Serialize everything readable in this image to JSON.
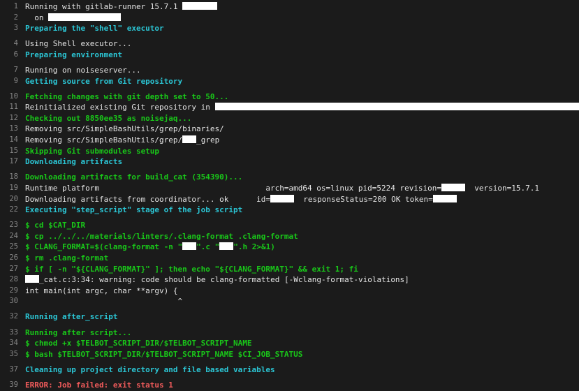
{
  "terminal": {
    "title": "GitLab CI job log",
    "background_color": "#1b1b1b",
    "colors": {
      "plain": "#e4e4e4",
      "section_header": "#2bc5d4",
      "status_green": "#19c719",
      "command_green": "#19c719",
      "error_red": "#f15b5b",
      "line_number": "#868686",
      "redaction": "#ffffff"
    },
    "lines": [
      {
        "number": "1",
        "style": "plain",
        "gap": false,
        "pre": "Running with gitlab-runner 15.7.1 ",
        "redact": "md",
        "post": ""
      },
      {
        "number": "2",
        "style": "plain",
        "gap": false,
        "pre": "  on ",
        "redact": "xl",
        "post": ""
      },
      {
        "number": "3",
        "style": "section",
        "gap": false,
        "text": "Preparing the \"shell\" executor"
      },
      {
        "number": "4",
        "style": "plain",
        "gap": true,
        "text": "Using Shell executor..."
      },
      {
        "number": "6",
        "style": "section",
        "gap": false,
        "text": "Preparing environment"
      },
      {
        "number": "7",
        "style": "plain",
        "gap": true,
        "text": "Running on noiseserver..."
      },
      {
        "number": "9",
        "style": "section",
        "gap": false,
        "text": "Getting source from Git repository"
      },
      {
        "number": "10",
        "style": "green",
        "gap": true,
        "text": "Fetching changes with git depth set to 50..."
      },
      {
        "number": "11",
        "style": "plain",
        "gap": false,
        "pre": "Reinitialized existing Git repository in ",
        "redact": "fill",
        "post": ""
      },
      {
        "number": "12",
        "style": "green",
        "gap": false,
        "text": "Checking out 8850ee35 as noisejaq..."
      },
      {
        "number": "13",
        "style": "plain",
        "gap": false,
        "text": "Removing src/SimpleBashUtils/grep/binaries/"
      },
      {
        "number": "14",
        "style": "plain",
        "gap": false,
        "pre": "Removing src/SimpleBashUtils/grep/",
        "redact": "xs",
        "post": "_grep"
      },
      {
        "number": "15",
        "style": "green",
        "gap": false,
        "text": "Skipping Git submodules setup"
      },
      {
        "number": "17",
        "style": "section",
        "gap": false,
        "text": "Downloading artifacts"
      },
      {
        "number": "18",
        "style": "green",
        "gap": true,
        "text": "Downloading artifacts for build_cat (354390)..."
      },
      {
        "number": "19",
        "style": "plain",
        "gap": false,
        "pre": "Runtime platform",
        "pad": 36,
        "pre2": "arch=amd64 os=linux pid=5224 revision=",
        "redact": "sm",
        "post": "  version=15.7.1"
      },
      {
        "number": "20",
        "style": "plain",
        "gap": false,
        "pre": "Downloading artifacts from coordinator... ok",
        "pad": 6,
        "pre2": "id=",
        "redact": "sm",
        "post2": "  responseStatus=200 OK token=",
        "redact2": "sm",
        "post": ""
      },
      {
        "number": "22",
        "style": "section",
        "gap": false,
        "text": "Executing \"step_script\" stage of the job script"
      },
      {
        "number": "23",
        "style": "cmd",
        "gap": true,
        "text": "$ cd $CAT_DIR"
      },
      {
        "number": "24",
        "style": "cmd",
        "gap": false,
        "text": "$ cp ../../../materials/linters/.clang-format .clang-format"
      },
      {
        "number": "25",
        "style": "cmd",
        "gap": false,
        "pre": "$ CLANG_FORMAT=$(clang-format -n \"",
        "redact": "xs",
        "post2": "\".c \"",
        "redact2": "xs",
        "post": "\".h 2>&1)"
      },
      {
        "number": "26",
        "style": "cmd",
        "gap": false,
        "text": "$ rm .clang-format"
      },
      {
        "number": "27",
        "style": "cmd",
        "gap": false,
        "text": "$ if [ -n \"${CLANG_FORMAT}\" ]; then echo \"${CLANG_FORMAT}\" && exit 1; fi"
      },
      {
        "number": "28",
        "style": "warn",
        "gap": false,
        "pre": "",
        "redact": "xs",
        "post": "_cat.c:3:34: warning: code should be clang-formatted [-Wclang-format-violations]"
      },
      {
        "number": "29",
        "style": "warn",
        "gap": false,
        "text": "int main(int argc, char **argv) {"
      },
      {
        "number": "30",
        "style": "warn",
        "gap": false,
        "text": "                                 ^"
      },
      {
        "number": "32",
        "style": "section",
        "gap": true,
        "text": "Running after_script"
      },
      {
        "number": "33",
        "style": "green",
        "gap": true,
        "text": "Running after script..."
      },
      {
        "number": "34",
        "style": "cmd",
        "gap": false,
        "text": "$ chmod +x $TELBOT_SCRIPT_DIR/$TELBOT_SCRIPT_NAME"
      },
      {
        "number": "35",
        "style": "cmd",
        "gap": false,
        "text": "$ bash $TELBOT_SCRIPT_DIR/$TELBOT_SCRIPT_NAME $CI_JOB_STATUS"
      },
      {
        "number": "37",
        "style": "section",
        "gap": true,
        "text": "Cleaning up project directory and file based variables"
      },
      {
        "number": "39",
        "style": "error",
        "gap": true,
        "text": "ERROR: Job failed: exit status 1"
      }
    ]
  }
}
